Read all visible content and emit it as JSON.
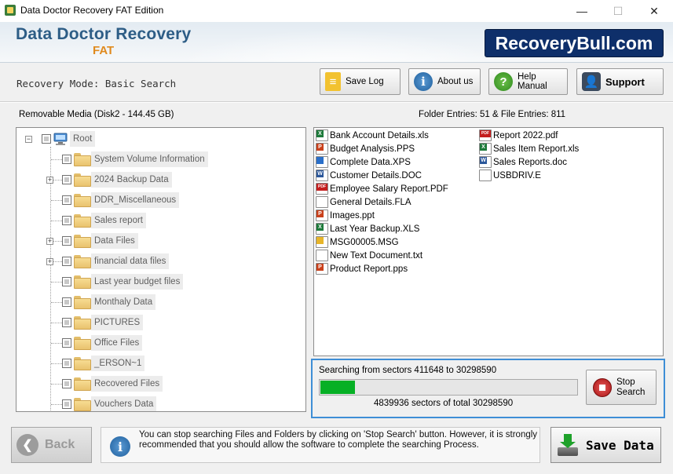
{
  "window": {
    "title": "Data Doctor Recovery FAT Edition",
    "minimize": "—",
    "maximize": "☐",
    "close": "✕"
  },
  "header": {
    "app_name": "Data Doctor Recovery",
    "edition": "FAT",
    "brand": "RecoveryBull.com"
  },
  "toolbar": {
    "mode": "Recovery Mode: Basic Search",
    "save_log": "Save Log",
    "about_us": "About us",
    "help_manual": "Help Manual",
    "support": "Support"
  },
  "media": {
    "label": "Removable Media (Disk2 - 144.45 GB)",
    "entries": "Folder Entries: 51 & File Entries: 811"
  },
  "tree": {
    "root": "Root",
    "folders": [
      {
        "label": "System Volume Information",
        "expandable": false
      },
      {
        "label": "2024 Backup Data",
        "expandable": true
      },
      {
        "label": "DDR_Miscellaneous",
        "expandable": false
      },
      {
        "label": "Sales report",
        "expandable": false
      },
      {
        "label": "Data Files",
        "expandable": true
      },
      {
        "label": "financial data files",
        "expandable": true
      },
      {
        "label": "Last year budget files",
        "expandable": false
      },
      {
        "label": "Monthaly Data",
        "expandable": false
      },
      {
        "label": "PICTURES",
        "expandable": false
      },
      {
        "label": "Office Files",
        "expandable": false
      },
      {
        "label": "_ERSON~1",
        "expandable": false
      },
      {
        "label": "Recovered Files",
        "expandable": false
      },
      {
        "label": "Vouchers Data",
        "expandable": false
      }
    ]
  },
  "files": {
    "col1": [
      {
        "name": "Bank Account Details.xls",
        "icon": "excel-icon",
        "color": "#1d7a3a",
        "badge": "X"
      },
      {
        "name": "Budget Analysis.PPS",
        "icon": "powerpoint-icon",
        "color": "#c9401b",
        "badge": "P"
      },
      {
        "name": "Complete Data.XPS",
        "icon": "xps-icon",
        "color": "#2a6fc9",
        "badge": ""
      },
      {
        "name": "Customer Details.DOC",
        "icon": "word-icon",
        "color": "#2b579a",
        "badge": "W"
      },
      {
        "name": "Employee Salary Report.PDF",
        "icon": "pdf-icon",
        "color": "#c41e1e",
        "badge": "PDF"
      },
      {
        "name": "General Details.FLA",
        "icon": "file-icon",
        "color": "#ffffff",
        "badge": ""
      },
      {
        "name": "Images.ppt",
        "icon": "powerpoint-icon",
        "color": "#c9401b",
        "badge": "P"
      },
      {
        "name": "Last Year Backup.XLS",
        "icon": "excel-icon",
        "color": "#1d7a3a",
        "badge": "X"
      },
      {
        "name": "MSG00005.MSG",
        "icon": "mail-icon",
        "color": "#e7b52a",
        "badge": ""
      },
      {
        "name": "New Text Document.txt",
        "icon": "text-file-icon",
        "color": "#ffffff",
        "badge": ""
      },
      {
        "name": "Product Report.pps",
        "icon": "powerpoint-icon",
        "color": "#c9401b",
        "badge": "P"
      }
    ],
    "col2": [
      {
        "name": "Report 2022.pdf",
        "icon": "pdf-icon",
        "color": "#c41e1e",
        "badge": "PDF"
      },
      {
        "name": "Sales Item Report.xls",
        "icon": "excel-icon",
        "color": "#1d7a3a",
        "badge": "X"
      },
      {
        "name": "Sales Reports.doc",
        "icon": "word-icon",
        "color": "#2b579a",
        "badge": "W"
      },
      {
        "name": "USBDRIV.E",
        "icon": "file-icon",
        "color": "#ffffff",
        "badge": ""
      }
    ]
  },
  "search": {
    "status": "Searching from sectors   411648 to 30298590",
    "progress_fraction": 0.14,
    "sectors_text": "4839936   sectors  of  total 30298590",
    "stop_line1": "Stop",
    "stop_line2": "Search"
  },
  "footer": {
    "back": "Back",
    "info": "You can stop searching Files and Folders by clicking on 'Stop Search' button. However, it is strongly recommended that you should allow the software to complete the searching Process.",
    "save_data": "Save Data"
  },
  "colors": {
    "accent": "#3e8ed6",
    "progress": "#06b025",
    "brand_bg": "#0e2f6a",
    "edition": "#e08a1e"
  }
}
